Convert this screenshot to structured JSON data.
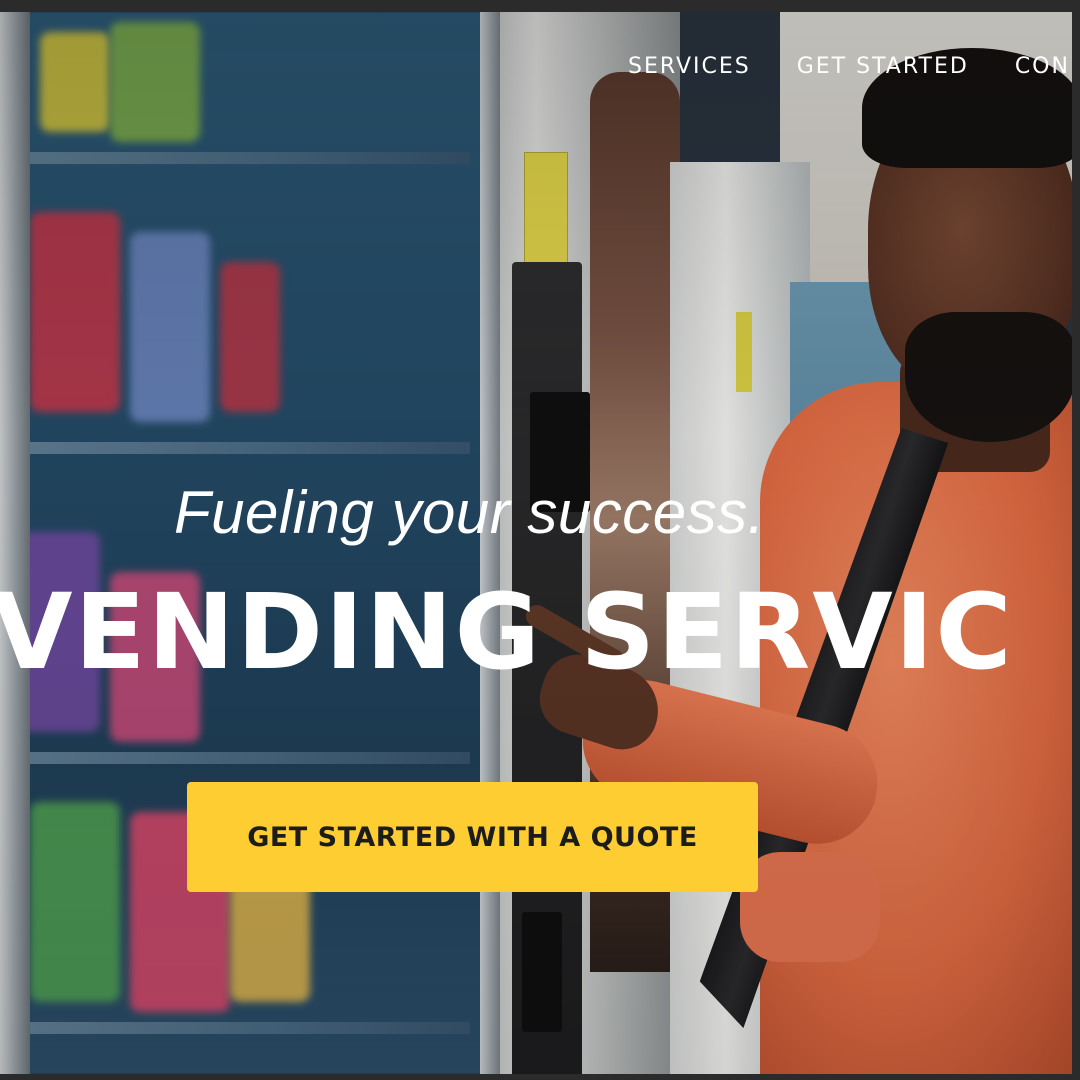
{
  "nav": {
    "items": [
      {
        "label": "SERVICES"
      },
      {
        "label": "GET STARTED"
      },
      {
        "label": "CON"
      }
    ]
  },
  "hero": {
    "tagline": "Fueling your success.",
    "headline": "VENDING SERVIC",
    "cta_label": "GET STARTED WITH A QUOTE",
    "background_image": "person-at-vending-machine-photo"
  },
  "colors": {
    "cta_background": "#fecd32",
    "cta_text": "#1c1c1c",
    "text": "#ffffff"
  }
}
